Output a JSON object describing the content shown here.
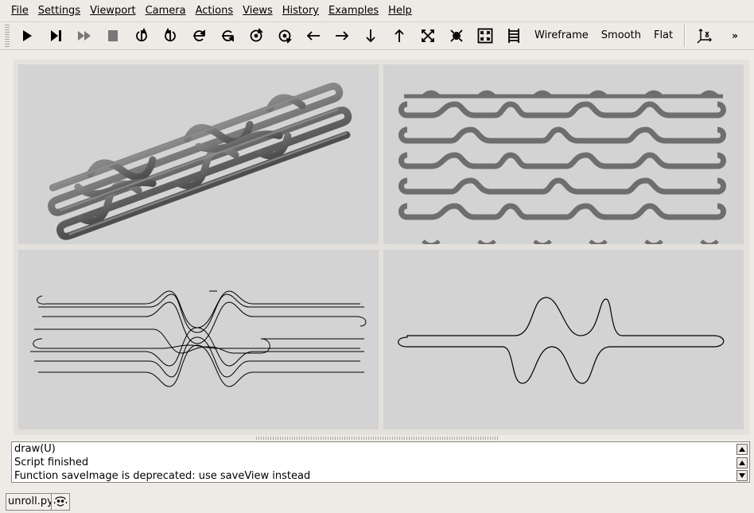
{
  "menu": [
    {
      "label": "File",
      "name": "file"
    },
    {
      "label": "Settings",
      "name": "settings"
    },
    {
      "label": "Viewport",
      "name": "viewport"
    },
    {
      "label": "Camera",
      "name": "camera"
    },
    {
      "label": "Actions",
      "name": "actions"
    },
    {
      "label": "Views",
      "name": "views"
    },
    {
      "label": "History",
      "name": "history"
    },
    {
      "label": "Examples",
      "name": "examples"
    },
    {
      "label": "Help",
      "name": "help"
    }
  ],
  "toolbar": {
    "icons": [
      "play-icon",
      "step-icon",
      "continue-icon",
      "stop-icon",
      "rotate-right-icon",
      "rotate-left-icon",
      "rotate-up-icon",
      "rotate-down-icon",
      "rotate-cw-icon",
      "rotate-ccw-icon",
      "arrow-left-icon",
      "arrow-right-icon",
      "arrow-down-icon",
      "arrow-up-icon",
      "zoom-in-icon",
      "zoom-out-icon",
      "zoom-all-icon",
      "ruler-icon"
    ],
    "wireframe_label": "Wireframe",
    "smooth_label": "Smooth",
    "flat_label": "Flat",
    "more_label": "»"
  },
  "viewports": {
    "background": "#d3d3d3",
    "mesh_color": "#6e6e6e",
    "line_color": "#000000"
  },
  "console": {
    "lines": [
      "draw(U)",
      "Script finished",
      "Function saveImage is deprecated: use saveView instead"
    ]
  },
  "statusbar": {
    "file_label": "unroll.py",
    "smiley_icon": "smiley-icon"
  }
}
